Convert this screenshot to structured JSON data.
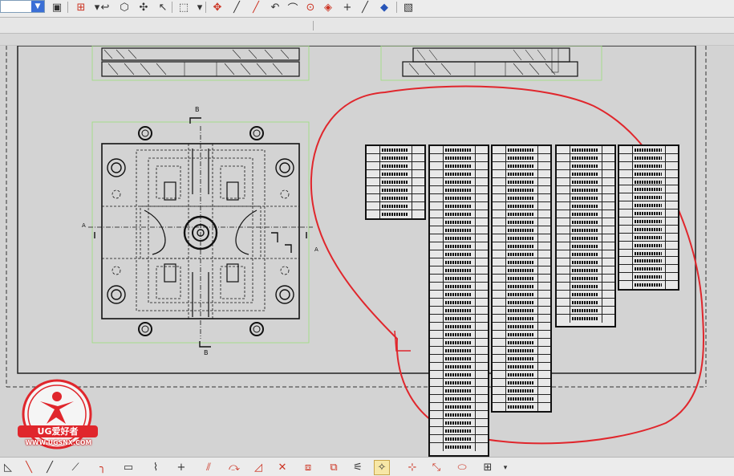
{
  "toolbar": {
    "layer_value": "",
    "buttons": [
      {
        "name": "print-icon",
        "glyph": "▣"
      },
      {
        "name": "new-view-icon",
        "glyph": "⊞"
      },
      {
        "name": "undo-icon",
        "glyph": "↩"
      },
      {
        "name": "shape-icon",
        "glyph": "⬡"
      },
      {
        "name": "snap-icon",
        "glyph": "✣"
      },
      {
        "name": "arrow-icon",
        "glyph": "↖"
      },
      {
        "name": "select-box-icon",
        "glyph": "⬚"
      },
      {
        "name": "move-icon",
        "glyph": "✥"
      },
      {
        "name": "line-icon",
        "glyph": "╱"
      },
      {
        "name": "point-line-icon",
        "glyph": "╱"
      },
      {
        "name": "arc-icon",
        "glyph": "↶"
      },
      {
        "name": "angle-icon",
        "glyph": "⌒"
      },
      {
        "name": "center-circle-icon",
        "glyph": "⊙"
      },
      {
        "name": "circle-point-icon",
        "glyph": "◈"
      },
      {
        "name": "crosshair-icon",
        "glyph": "+"
      },
      {
        "name": "pencil-icon",
        "glyph": "╱"
      },
      {
        "name": "color-icon",
        "glyph": "◆"
      },
      {
        "name": "layer-cube-icon",
        "glyph": "▧"
      }
    ]
  },
  "drawing": {
    "view_label_top": "B",
    "view_label_bottom": "B",
    "view_label_left": "A",
    "view_label_right": "A"
  },
  "logo": {
    "title": "UG爱好者",
    "url": "WWW.UGSNX.COM"
  },
  "bottom_toolbar": {
    "buttons": [
      {
        "name": "triangle-icon",
        "glyph": "◺"
      },
      {
        "name": "line-tool-icon",
        "glyph": "╲"
      },
      {
        "name": "polyline-icon",
        "glyph": "╱"
      },
      {
        "name": "offset-line-icon",
        "glyph": "⟋"
      },
      {
        "name": "fillet-icon",
        "glyph": "╮"
      },
      {
        "name": "rectangle-icon",
        "glyph": "▭"
      },
      {
        "name": "spline-icon",
        "glyph": "⌇"
      },
      {
        "name": "cross-icon",
        "glyph": "+"
      },
      {
        "name": "trim-icon",
        "glyph": "⫽"
      },
      {
        "name": "extend-icon",
        "glyph": "⤼"
      },
      {
        "name": "corner-icon",
        "glyph": "◿"
      },
      {
        "name": "delete-curve-icon",
        "glyph": "✕"
      },
      {
        "name": "mirror-icon",
        "glyph": "⧈"
      },
      {
        "name": "pattern-icon",
        "glyph": "⧉"
      },
      {
        "name": "constraint-icon",
        "glyph": "⚟"
      },
      {
        "name": "snap-grid-icon",
        "glyph": "✧"
      },
      {
        "name": "point-tool-icon",
        "glyph": "⊹"
      },
      {
        "name": "dimension-icon",
        "glyph": "⤡"
      },
      {
        "name": "region-icon",
        "glyph": "⬭"
      },
      {
        "name": "table-tool-icon",
        "glyph": "⊞"
      }
    ]
  },
  "colors": {
    "markup_circle": "#e0262c",
    "background": "#d3d3d3",
    "view_border": "#9be07a"
  }
}
